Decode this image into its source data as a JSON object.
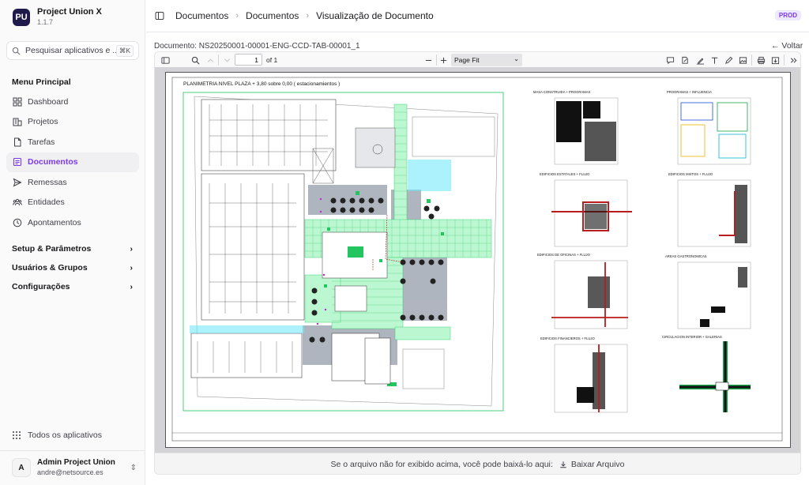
{
  "app": {
    "name": "Project Union X",
    "version": "1.1.7",
    "logo_text": "PU"
  },
  "search": {
    "placeholder": "Pesquisar aplicativos e ...",
    "shortcut": "⌘K"
  },
  "sidebar": {
    "section_title": "Menu Principal",
    "items": [
      {
        "label": "Dashboard",
        "icon": "dashboard-icon",
        "active": false
      },
      {
        "label": "Projetos",
        "icon": "building-icon",
        "active": false
      },
      {
        "label": "Tarefas",
        "icon": "file-icon",
        "active": false
      },
      {
        "label": "Documentos",
        "icon": "document-icon",
        "active": true
      },
      {
        "label": "Remessas",
        "icon": "send-icon",
        "active": false
      },
      {
        "label": "Entidades",
        "icon": "users-icon",
        "active": false
      },
      {
        "label": "Apontamentos",
        "icon": "clock-icon",
        "active": false
      }
    ],
    "groups": [
      {
        "label": "Setup & Parâmetros"
      },
      {
        "label": "Usuários & Grupos"
      },
      {
        "label": "Configurações"
      }
    ],
    "all_apps": "Todos os aplicativos"
  },
  "user": {
    "initial": "A",
    "name": "Admin Project Union",
    "email": "andre@netsource.es"
  },
  "header": {
    "breadcrumb": [
      "Documentos",
      "Documentos",
      "Visualização de Documento"
    ],
    "env_badge": "PROD"
  },
  "document": {
    "label": "Documento: NS20250001-00001-ENG-CCD-TAB-00001_1",
    "back": "Voltar"
  },
  "pdf_toolbar": {
    "current_page": "1",
    "page_of": "of 1",
    "zoom": "Page Fit"
  },
  "drawing": {
    "sheet_title": "PLANIMETRIA NIVEL PLAZA + 3,80 sobre 0,00  ( estacionamientos )",
    "diagram_labels": [
      "MASA CONSTRUIDA + PROGRAMAS",
      "PROGRAMAS + INFLUENCIA",
      "EDIFICIOS ESTATALES + FLUJO",
      "EDIFICIOS MIXTOS + FLUJO",
      "EDIFICIOS DE OFICINAS + FLUJO",
      "AREAS GASTRONOMICAS",
      "EDIFICIOS FINANCIEROS + FLUJO",
      "CIRCULACION INTERIOR + GALERIAS"
    ]
  },
  "footer": {
    "message": "Se o arquivo não for exibido acima, você pode baixá-lo aqui:",
    "download": "Baixar Arquivo"
  },
  "colors": {
    "accent": "#7c3aed",
    "plan_green": "#22c55e",
    "plan_red": "#b91c1c"
  }
}
